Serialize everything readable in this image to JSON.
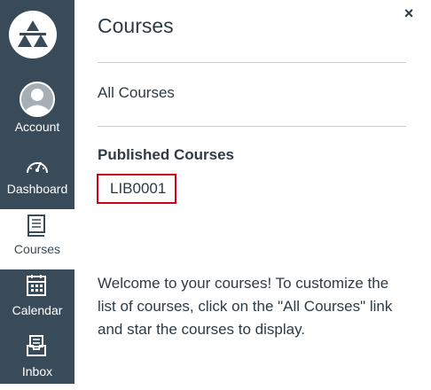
{
  "global_nav": {
    "items": [
      {
        "label": "Account"
      },
      {
        "label": "Dashboard"
      },
      {
        "label": "Courses"
      },
      {
        "label": "Calendar"
      },
      {
        "label": "Inbox"
      }
    ]
  },
  "tray": {
    "title": "Courses",
    "close_label": "×",
    "all_courses_label": "All Courses",
    "published_heading": "Published Courses",
    "courses": [
      "LIB0001"
    ],
    "welcome_text": "Welcome to your courses! To customize the list of courses, click on the \"All Courses\" link and star the courses to display."
  },
  "colors": {
    "nav_background": "#394b58",
    "highlight_border": "#d0021b",
    "text": "#2d3b45",
    "divider": "#c7cdd1"
  }
}
